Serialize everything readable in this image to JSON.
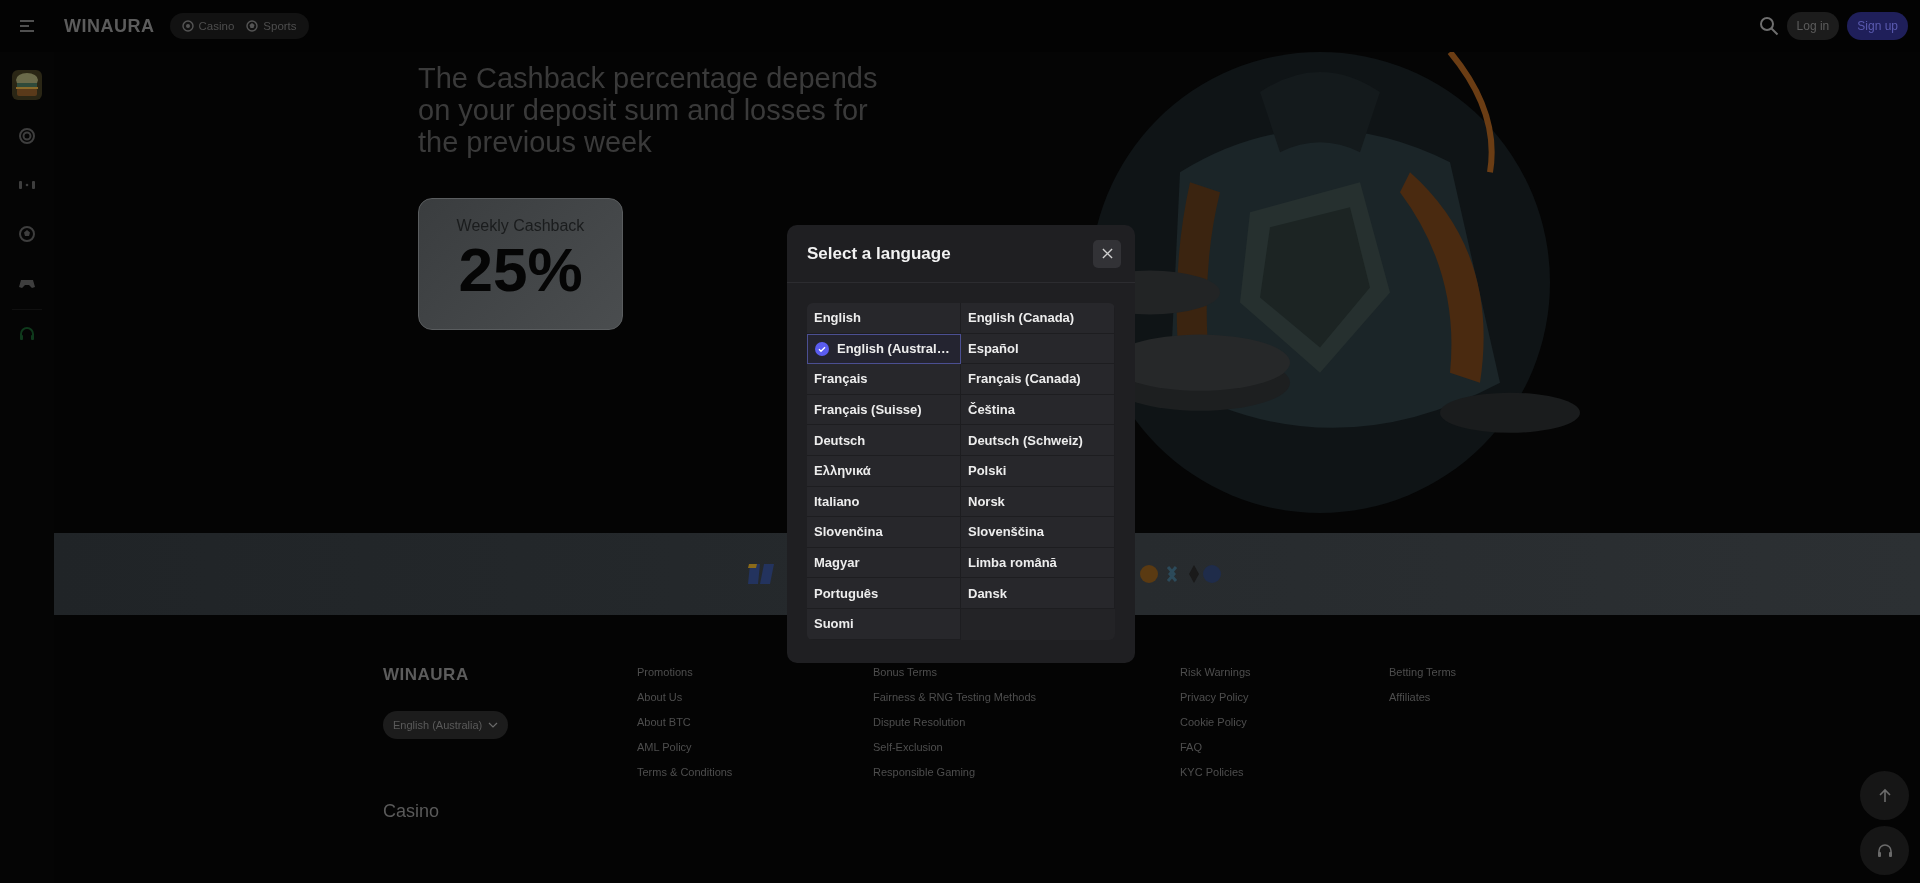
{
  "top_bar": {
    "logo": "WINAURA",
    "nav_tabs": [
      {
        "label": "Casino",
        "kind": "casino"
      },
      {
        "label": "Sports",
        "kind": "sports"
      }
    ],
    "buttons": [
      {
        "label": "Log in",
        "kind": "secondary"
      },
      {
        "label": "Sign up",
        "kind": "primary"
      }
    ]
  },
  "hero": {
    "headline": "The Cashback percentage depends on your deposit sum and losses for the previous week",
    "card": {
      "label": "Weekly Cashback",
      "value": "25%"
    }
  },
  "footer": {
    "logo": "WINAURA",
    "language": "English (Australia)",
    "link_columns": [
      [
        "Promotions",
        "About Us",
        "About BTC",
        "AML Policy",
        "Terms & Conditions"
      ],
      [
        "Bonus Terms",
        "Fairness & RNG Testing Methods",
        "Dispute Resolution",
        "Self-Exclusion",
        "Responsible Gaming"
      ],
      [
        "Risk Warnings",
        "Privacy Policy",
        "Cookie Policy",
        "FAQ",
        "KYC Policies"
      ],
      [
        "Betting Terms",
        "Affiliates"
      ]
    ],
    "section_title": "Casino"
  },
  "language_dialog": {
    "title": "Select a language",
    "languages": [
      {
        "label": "English",
        "selected": false
      },
      {
        "label": "English (Canada)",
        "selected": false
      },
      {
        "label": "English (Austral…",
        "selected": true
      },
      {
        "label": "Español",
        "selected": false
      },
      {
        "label": "Français",
        "selected": false
      },
      {
        "label": "Français (Canada)",
        "selected": false
      },
      {
        "label": "Français (Suisse)",
        "selected": false
      },
      {
        "label": "Čeština",
        "selected": false
      },
      {
        "label": "Deutsch",
        "selected": false
      },
      {
        "label": "Deutsch (Schweiz)",
        "selected": false
      },
      {
        "label": "Ελληνικά",
        "selected": false
      },
      {
        "label": "Polski",
        "selected": false
      },
      {
        "label": "Italiano",
        "selected": false
      },
      {
        "label": "Norsk",
        "selected": false
      },
      {
        "label": "Slovenčina",
        "selected": false
      },
      {
        "label": "Slovenščina",
        "selected": false
      },
      {
        "label": "Magyar",
        "selected": false
      },
      {
        "label": "Limba română",
        "selected": false
      },
      {
        "label": "Português",
        "selected": false
      },
      {
        "label": "Dansk",
        "selected": false
      },
      {
        "label": "Suomi",
        "selected": false
      }
    ]
  }
}
